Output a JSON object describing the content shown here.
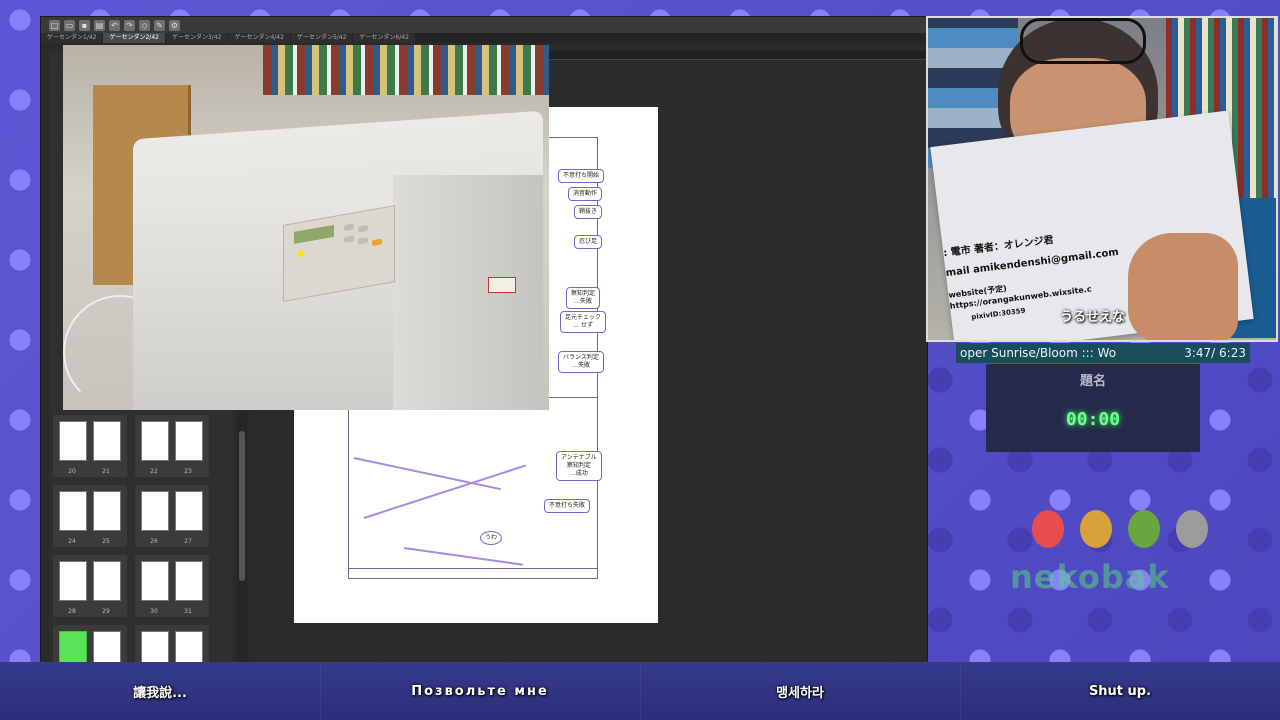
{
  "clip_studio": {
    "tabs": [
      "ゲーセンダン1/42",
      "ゲーセンダン2/42",
      "ゲーセンダン3/42",
      "ゲーセンダン4/42",
      "ゲーセンダン5/42",
      "ゲーセンダン6/42"
    ],
    "active_tab_index": 1,
    "page_numbers": [
      "20",
      "21",
      "22",
      "23",
      "24",
      "25",
      "26",
      "27",
      "28",
      "29",
      "30",
      "31"
    ],
    "manga_notes": {
      "fuiuchi_start": "不意打ち開始",
      "shouon": "消音動作",
      "hakunuki": "鞘抜き",
      "shinobiashi": "忍び足",
      "sacchi_fail": "察知判定\n…失敗",
      "ashimoto": "足元チェック\n… せず",
      "balance": "バランス判定\n…失敗",
      "antenna": "アンテナブル\n察知判定\n…成功",
      "fuiuchi_fail": "不意打ち失敗",
      "uwa": "うわ"
    }
  },
  "webcam": {
    "paper_lines": [
      ": 電市  著者：オレンジ君",
      "mail amikendenshi@gmail.com",
      "website(予定)",
      "https://orangakunweb.wixsite.c",
      "pixivID:30359"
    ],
    "caption": "うるせえな"
  },
  "music": {
    "title": "oper Sunrise/Bloom  :::  Wo",
    "time": "3:47/ 6:23"
  },
  "timer": {
    "heading": "題名",
    "value": "00:00"
  },
  "logo": {
    "text": "nekobak"
  },
  "subtitles": [
    "讓我說...",
    "Позвольте мне",
    "맹세하라",
    "Shut up."
  ]
}
